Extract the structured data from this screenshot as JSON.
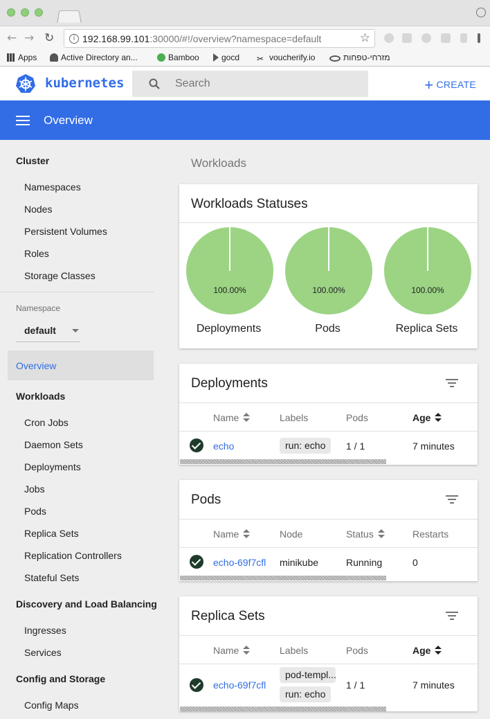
{
  "browser": {
    "url_host": "192.168.99.101",
    "url_rest": ":30000/#!/overview?namespace=default",
    "bookmarks": [
      "Apps",
      "Active Directory an...",
      "Bamboo",
      "gocd",
      "voucherify.io",
      "מזרחי-טפחות"
    ]
  },
  "header": {
    "brand": "kubernetes",
    "search_placeholder": "Search",
    "create_label": "CREATE"
  },
  "title_bar": {
    "title": "Overview"
  },
  "sidebar": {
    "cluster_heading": "Cluster",
    "cluster_items": [
      "Namespaces",
      "Nodes",
      "Persistent Volumes",
      "Roles",
      "Storage Classes"
    ],
    "namespace_label": "Namespace",
    "namespace_value": "default",
    "active_item": "Overview",
    "workloads_heading": "Workloads",
    "workloads_items": [
      "Cron Jobs",
      "Daemon Sets",
      "Deployments",
      "Jobs",
      "Pods",
      "Replica Sets",
      "Replication Controllers",
      "Stateful Sets"
    ],
    "discovery_heading": "Discovery and Load Balancing",
    "discovery_items": [
      "Ingresses",
      "Services"
    ],
    "config_heading": "Config and Storage",
    "config_items": [
      "Config Maps"
    ]
  },
  "main": {
    "section_label": "Workloads",
    "statuses": {
      "title": "Workloads Statuses",
      "charts": [
        {
          "name": "Deployments",
          "percent_label": "100.00%",
          "running_fraction": 1.0
        },
        {
          "name": "Pods",
          "percent_label": "100.00%",
          "running_fraction": 1.0
        },
        {
          "name": "Replica Sets",
          "percent_label": "100.00%",
          "running_fraction": 1.0
        }
      ],
      "color_running": "#9cd484"
    },
    "deployments": {
      "title": "Deployments",
      "headers": [
        "Name",
        "Labels",
        "Pods",
        "Age"
      ],
      "rows": [
        {
          "name": "echo",
          "labels": [
            "run: echo"
          ],
          "pods": "1 / 1",
          "age": "7 minutes"
        }
      ]
    },
    "pods": {
      "title": "Pods",
      "headers": [
        "Name",
        "Node",
        "Status",
        "Restarts"
      ],
      "rows": [
        {
          "name": "echo-69f7cfl",
          "node": "minikube",
          "status": "Running",
          "restarts": "0"
        }
      ]
    },
    "replica_sets": {
      "title": "Replica Sets",
      "headers": [
        "Name",
        "Labels",
        "Pods",
        "Age"
      ],
      "rows": [
        {
          "name": "echo-69f7cfl",
          "labels": [
            "pod-templ...",
            "run: echo"
          ],
          "pods": "1 / 1",
          "age": "7 minutes"
        }
      ]
    }
  },
  "colors": {
    "accent": "#326de6",
    "sidebar_bg": "#eeeeee"
  }
}
